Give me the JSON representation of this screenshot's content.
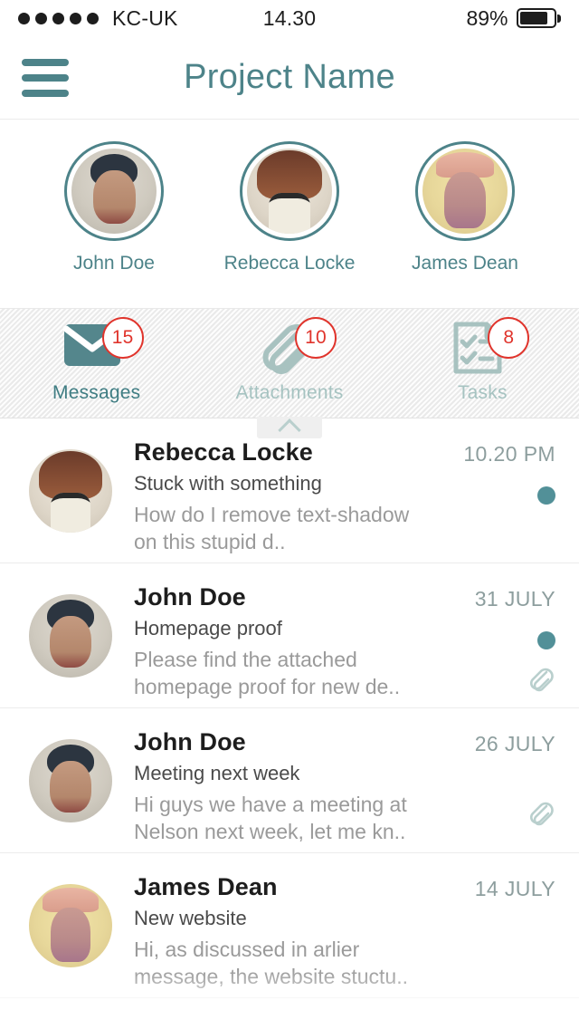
{
  "status_bar": {
    "signal_dots": 5,
    "carrier": "KC-UK",
    "time": "14.30",
    "battery_percent": "89%"
  },
  "header": {
    "menu_icon": "hamburger-icon",
    "title": "Project Name"
  },
  "team": {
    "members": [
      {
        "name": "John Doe",
        "avatar": "john-doe-avatar"
      },
      {
        "name": "Rebecca Locke",
        "avatar": "rebecca-locke-avatar"
      },
      {
        "name": "James Dean",
        "avatar": "james-dean-avatar"
      }
    ]
  },
  "tabs": {
    "items": [
      {
        "label": "Messages",
        "badge": "15",
        "icon": "envelope-icon",
        "active": true
      },
      {
        "label": "Attachments",
        "badge": "10",
        "icon": "paperclip-icon",
        "active": false
      },
      {
        "label": "Tasks",
        "badge": "8",
        "icon": "checklist-icon",
        "active": false
      }
    ],
    "drawer_handle_icon": "chevron-up-icon"
  },
  "messages": [
    {
      "sender": "Rebecca Locke",
      "subject": "Stuck with something",
      "preview": "How do I remove text-shadow on this stupid d..",
      "time": "10.20 PM",
      "unread": true,
      "has_attachment": false,
      "avatar": "rebecca-locke-avatar"
    },
    {
      "sender": "John Doe",
      "subject": "Homepage proof",
      "preview": "Please find the attached homepage proof for new de..",
      "time": "31 JULY",
      "unread": true,
      "has_attachment": true,
      "avatar": "john-doe-avatar"
    },
    {
      "sender": "John Doe",
      "subject": "Meeting next week",
      "preview": "Hi guys we have a meeting at Nelson next week, let me kn..",
      "time": "26 JULY",
      "unread": false,
      "has_attachment": true,
      "avatar": "john-doe-avatar"
    },
    {
      "sender": "James Dean",
      "subject": "New website",
      "preview": "Hi, as discussed in arlier message, the website stuctu..",
      "time": "14 JULY",
      "unread": false,
      "has_attachment": false,
      "avatar": "james-dean-avatar"
    }
  ],
  "colors": {
    "accent_teal": "#4d8389",
    "muted_teal": "#a6c3c1",
    "badge_red": "#e0342c",
    "unread_dot": "#529098",
    "time_grey": "#8d9e9e",
    "preview_grey": "#9a9a9a"
  }
}
